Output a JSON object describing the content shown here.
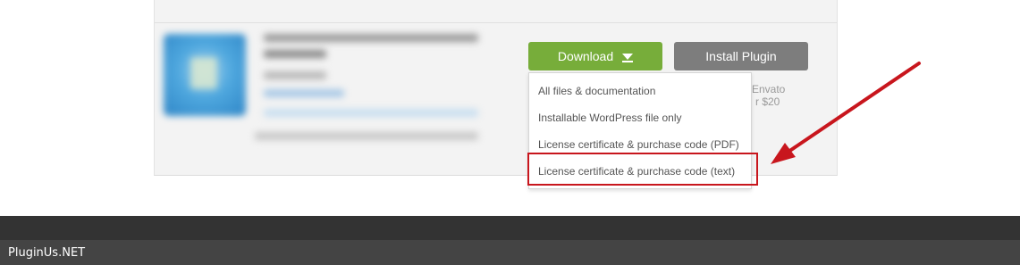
{
  "product": {
    "download_label": "Download",
    "install_label": "Install Plugin",
    "side_text_line1": "Envato",
    "side_text_line2": "r $20"
  },
  "download_menu": {
    "items": [
      "All files & documentation",
      "Installable WordPress file only",
      "License certificate & purchase code (PDF)",
      "License certificate & purchase code (text)"
    ]
  },
  "annotation": {
    "highlight_color": "#c8161d"
  },
  "footer": {
    "brand": "PluginUs.NET"
  },
  "colors": {
    "download_button": "#77ad3a",
    "install_button": "#7d7d7d",
    "footer_dark": "#333333",
    "footer_bar": "#444444"
  }
}
